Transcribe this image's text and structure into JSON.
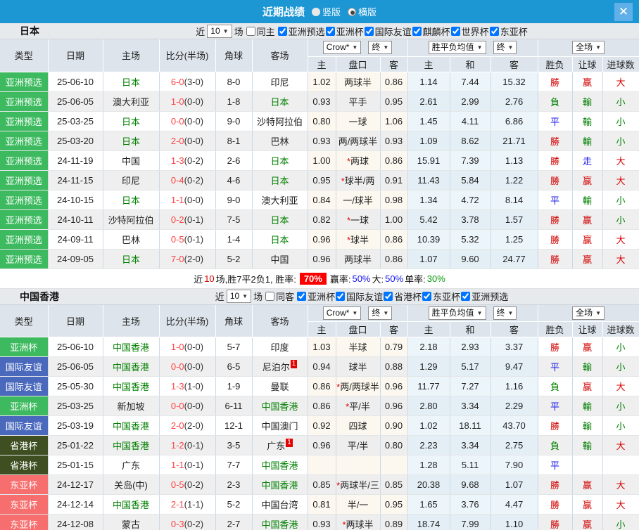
{
  "colors": {
    "titlebar_bg": "#1d97d4",
    "close_bg": "#5fb0e8",
    "badge_green": "#3dba5f",
    "badge_blue": "#4a69bd",
    "badge_olive": "#3f4f22",
    "badge_salmon": "#f76e6e",
    "win_red": "#d40000",
    "lose_green": "#008000",
    "draw_blue": "#1414ee",
    "score_red": "#ff4242",
    "rate_badge_bg": "#ff0000"
  },
  "titlebar": {
    "title": "近期战绩",
    "radio_vertical": "竖版",
    "radio_horizontal": "横版",
    "selected": "横版",
    "close": "✕"
  },
  "table_header": {
    "col_type": "类型",
    "col_date": "日期",
    "col_home": "主场",
    "col_score": "比分(半场)",
    "col_corner": "角球",
    "col_away": "客场",
    "crow_select": "Crow*",
    "final_select": "终",
    "mean_select": "胜平负均值",
    "final_select2": "终",
    "scope_select": "全场",
    "sub_home": "主",
    "sub_handicap": "盘口",
    "sub_away": "客",
    "sub_mhome": "主",
    "sub_mdraw": "和",
    "sub_maway": "客",
    "sub_wdl": "胜负",
    "sub_hresult": "让球",
    "sub_goals": "进球数"
  },
  "sections": [
    {
      "team": "日本",
      "filter": {
        "near": "近",
        "count": "10",
        "games": "场",
        "same_label": "同主",
        "same_checked": false,
        "competitions": [
          "亚洲预选",
          "亚洲杯",
          "国际友谊",
          "麒麟杯",
          "世界杯",
          "东亚杯"
        ]
      },
      "rows": [
        {
          "type": "亚洲预选",
          "type_color": "green",
          "date": "25-06-10",
          "home": "日本",
          "home_hl": true,
          "home_badge": "",
          "score": "6-0",
          "half": "(3-0)",
          "corner": "8-0",
          "away": "印尼",
          "away_hl": false,
          "away_badge": "",
          "o1": "1.02",
          "hc": "两球半",
          "o2": "0.86",
          "m1": "1.14",
          "m2": "7.44",
          "m3": "15.32",
          "r1": "勝",
          "r2": "赢",
          "r3": "大"
        },
        {
          "type": "亚洲预选",
          "type_color": "green",
          "date": "25-06-05",
          "home": "澳大利亚",
          "home_hl": false,
          "home_badge": "",
          "score": "1-0",
          "half": "(0-0)",
          "corner": "1-8",
          "away": "日本",
          "away_hl": true,
          "away_badge": "",
          "o1": "0.93",
          "hc": "平手",
          "o2": "0.95",
          "m1": "2.61",
          "m2": "2.99",
          "m3": "2.76",
          "r1": "負",
          "r2": "輸",
          "r3": "小"
        },
        {
          "type": "亚洲预选",
          "type_color": "green",
          "date": "25-03-25",
          "home": "日本",
          "home_hl": true,
          "home_badge": "",
          "score": "0-0",
          "half": "(0-0)",
          "corner": "9-0",
          "away": "沙特阿拉伯",
          "away_hl": false,
          "away_badge": "",
          "o1": "0.80",
          "hc": "一球",
          "o2": "1.06",
          "m1": "1.45",
          "m2": "4.11",
          "m3": "6.86",
          "r1": "平",
          "r2": "輸",
          "r3": "小"
        },
        {
          "type": "亚洲预选",
          "type_color": "green",
          "date": "25-03-20",
          "home": "日本",
          "home_hl": true,
          "home_badge": "",
          "score": "2-0",
          "half": "(0-0)",
          "corner": "8-1",
          "away": "巴林",
          "away_hl": false,
          "away_badge": "",
          "o1": "0.93",
          "hc": "两/两球半",
          "o2": "0.93",
          "m1": "1.09",
          "m2": "8.62",
          "m3": "21.71",
          "r1": "勝",
          "r2": "輸",
          "r3": "小"
        },
        {
          "type": "亚洲预选",
          "type_color": "green",
          "date": "24-11-19",
          "home": "中国",
          "home_hl": false,
          "home_badge": "",
          "score": "1-3",
          "half": "(0-2)",
          "corner": "2-6",
          "away": "日本",
          "away_hl": true,
          "away_badge": "",
          "o1": "1.00",
          "hc": "*两球",
          "o2": "0.86",
          "m1": "15.91",
          "m2": "7.39",
          "m3": "1.13",
          "r1": "勝",
          "r2": "走",
          "r3": "大"
        },
        {
          "type": "亚洲预选",
          "type_color": "green",
          "date": "24-11-15",
          "home": "印尼",
          "home_hl": false,
          "home_badge": "",
          "score": "0-4",
          "half": "(0-2)",
          "corner": "4-6",
          "away": "日本",
          "away_hl": true,
          "away_badge": "",
          "o1": "0.95",
          "hc": "*球半/两",
          "o2": "0.91",
          "m1": "11.43",
          "m2": "5.84",
          "m3": "1.22",
          "r1": "勝",
          "r2": "赢",
          "r3": "大"
        },
        {
          "type": "亚洲预选",
          "type_color": "green",
          "date": "24-10-15",
          "home": "日本",
          "home_hl": true,
          "home_badge": "",
          "score": "1-1",
          "half": "(0-0)",
          "corner": "9-0",
          "away": "澳大利亚",
          "away_hl": false,
          "away_badge": "",
          "o1": "0.84",
          "hc": "一/球半",
          "o2": "0.98",
          "m1": "1.34",
          "m2": "4.72",
          "m3": "8.14",
          "r1": "平",
          "r2": "輸",
          "r3": "小"
        },
        {
          "type": "亚洲预选",
          "type_color": "green",
          "date": "24-10-11",
          "home": "沙特阿拉伯",
          "home_hl": false,
          "home_badge": "",
          "score": "0-2",
          "half": "(0-1)",
          "corner": "7-5",
          "away": "日本",
          "away_hl": true,
          "away_badge": "",
          "o1": "0.82",
          "hc": "*一球",
          "o2": "1.00",
          "m1": "5.42",
          "m2": "3.78",
          "m3": "1.57",
          "r1": "勝",
          "r2": "赢",
          "r3": "小"
        },
        {
          "type": "亚洲预选",
          "type_color": "green",
          "date": "24-09-11",
          "home": "巴林",
          "home_hl": false,
          "home_badge": "",
          "score": "0-5",
          "half": "(0-1)",
          "corner": "1-4",
          "away": "日本",
          "away_hl": true,
          "away_badge": "",
          "o1": "0.96",
          "hc": "*球半",
          "o2": "0.86",
          "m1": "10.39",
          "m2": "5.32",
          "m3": "1.25",
          "r1": "勝",
          "r2": "赢",
          "r3": "大"
        },
        {
          "type": "亚洲预选",
          "type_color": "green",
          "date": "24-09-05",
          "home": "日本",
          "home_hl": true,
          "home_badge": "",
          "score": "7-0",
          "half": "(2-0)",
          "corner": "5-2",
          "away": "中国",
          "away_hl": false,
          "away_badge": "",
          "o1": "0.96",
          "hc": "两球半",
          "o2": "0.86",
          "m1": "1.07",
          "m2": "9.60",
          "m3": "24.77",
          "r1": "勝",
          "r2": "赢",
          "r3": "大"
        }
      ],
      "summary_parts": [
        {
          "text": "近",
          "cls": ""
        },
        {
          "text": "10",
          "cls": "t-red"
        },
        {
          "text": "场,胜7平2负1, 胜率:",
          "cls": ""
        },
        {
          "text": "70%",
          "cls": "badge-rate"
        },
        {
          "text": "赢率:",
          "cls": ""
        },
        {
          "text": "50%",
          "cls": "t-blue"
        },
        {
          "text": " 大:",
          "cls": ""
        },
        {
          "text": "50%",
          "cls": "t-blue"
        },
        {
          "text": " 单率:",
          "cls": ""
        },
        {
          "text": "30%",
          "cls": "t-green2"
        }
      ]
    },
    {
      "team": "中国香港",
      "filter": {
        "near": "近",
        "count": "10",
        "games": "场",
        "same_label": "同客",
        "same_checked": false,
        "competitions": [
          "亚洲杯",
          "国际友谊",
          "省港杯",
          "东亚杯",
          "亚洲预选"
        ]
      },
      "rows": [
        {
          "type": "亚洲杯",
          "type_color": "green",
          "date": "25-06-10",
          "home": "中国香港",
          "home_hl": true,
          "home_badge": "",
          "score": "1-0",
          "half": "(0-0)",
          "corner": "5-7",
          "away": "印度",
          "away_hl": false,
          "away_badge": "",
          "o1": "1.03",
          "hc": "半球",
          "o2": "0.79",
          "m1": "2.18",
          "m2": "2.93",
          "m3": "3.37",
          "r1": "勝",
          "r2": "赢",
          "r3": "小"
        },
        {
          "type": "国际友谊",
          "type_color": "blue",
          "date": "25-06-05",
          "home": "中国香港",
          "home_hl": true,
          "home_badge": "",
          "score": "0-0",
          "half": "(0-0)",
          "corner": "6-5",
          "away": "尼泊尔",
          "away_hl": false,
          "away_badge": "1",
          "o1": "0.94",
          "hc": "球半",
          "o2": "0.88",
          "m1": "1.29",
          "m2": "5.17",
          "m3": "9.47",
          "r1": "平",
          "r2": "輸",
          "r3": "小"
        },
        {
          "type": "国际友谊",
          "type_color": "blue",
          "date": "25-05-30",
          "home": "中国香港",
          "home_hl": true,
          "home_badge": "",
          "score": "1-3",
          "half": "(1-0)",
          "corner": "1-9",
          "away": "曼联",
          "away_hl": false,
          "away_badge": "",
          "o1": "0.86",
          "hc": "*两/两球半",
          "o2": "0.96",
          "m1": "11.77",
          "m2": "7.27",
          "m3": "1.16",
          "r1": "負",
          "r2": "赢",
          "r3": "大"
        },
        {
          "type": "亚洲杯",
          "type_color": "green",
          "date": "25-03-25",
          "home": "新加坡",
          "home_hl": false,
          "home_badge": "",
          "score": "0-0",
          "half": "(0-0)",
          "corner": "6-11",
          "away": "中国香港",
          "away_hl": true,
          "away_badge": "",
          "o1": "0.86",
          "hc": "*平/半",
          "o2": "0.96",
          "m1": "2.80",
          "m2": "3.34",
          "m3": "2.29",
          "r1": "平",
          "r2": "輸",
          "r3": "小"
        },
        {
          "type": "国际友谊",
          "type_color": "blue",
          "date": "25-03-19",
          "home": "中国香港",
          "home_hl": true,
          "home_badge": "",
          "score": "2-0",
          "half": "(2-0)",
          "corner": "12-1",
          "away": "中国澳门",
          "away_hl": false,
          "away_badge": "",
          "o1": "0.92",
          "hc": "四球",
          "o2": "0.90",
          "m1": "1.02",
          "m2": "18.11",
          "m3": "43.70",
          "r1": "勝",
          "r2": "輸",
          "r3": "小"
        },
        {
          "type": "省港杯",
          "type_color": "olive",
          "date": "25-01-22",
          "home": "中国香港",
          "home_hl": true,
          "home_badge": "",
          "score": "1-2",
          "half": "(0-1)",
          "corner": "3-5",
          "away": "广东",
          "away_hl": false,
          "away_badge": "1",
          "o1": "0.96",
          "hc": "平/半",
          "o2": "0.80",
          "m1": "2.23",
          "m2": "3.34",
          "m3": "2.75",
          "r1": "負",
          "r2": "輸",
          "r3": "大"
        },
        {
          "type": "省港杯",
          "type_color": "olive",
          "date": "25-01-15",
          "home": "广东",
          "home_hl": false,
          "home_badge": "",
          "score": "1-1",
          "half": "(0-1)",
          "corner": "7-7",
          "away": "中国香港",
          "away_hl": true,
          "away_badge": "",
          "o1": "",
          "hc": "",
          "o2": "",
          "m1": "1.28",
          "m2": "5.11",
          "m3": "7.90",
          "r1": "平",
          "r2": "",
          "r3": ""
        },
        {
          "type": "东亚杯",
          "type_color": "salmon",
          "date": "24-12-17",
          "home": "关岛(中)",
          "home_hl": false,
          "home_badge": "",
          "score": "0-5",
          "half": "(0-2)",
          "corner": "2-3",
          "away": "中国香港",
          "away_hl": true,
          "away_badge": "",
          "o1": "0.85",
          "hc": "*两球半/三",
          "o2": "0.85",
          "m1": "20.38",
          "m2": "9.68",
          "m3": "1.07",
          "r1": "勝",
          "r2": "赢",
          "r3": "大"
        },
        {
          "type": "东亚杯",
          "type_color": "salmon",
          "date": "24-12-14",
          "home": "中国香港",
          "home_hl": true,
          "home_badge": "",
          "score": "2-1",
          "half": "(1-1)",
          "corner": "5-2",
          "away": "中国台湾",
          "away_hl": false,
          "away_badge": "",
          "o1": "0.81",
          "hc": "半/一",
          "o2": "0.95",
          "m1": "1.65",
          "m2": "3.76",
          "m3": "4.47",
          "r1": "勝",
          "r2": "赢",
          "r3": "大"
        },
        {
          "type": "东亚杯",
          "type_color": "salmon",
          "date": "24-12-08",
          "home": "蒙古",
          "home_hl": false,
          "home_badge": "",
          "score": "0-3",
          "half": "(0-2)",
          "corner": "2-7",
          "away": "中国香港",
          "away_hl": true,
          "away_badge": "",
          "o1": "0.93",
          "hc": "*两球半",
          "o2": "0.89",
          "m1": "18.74",
          "m2": "7.99",
          "m3": "1.10",
          "r1": "勝",
          "r2": "赢",
          "r3": "小"
        }
      ],
      "summary_parts": []
    }
  ]
}
